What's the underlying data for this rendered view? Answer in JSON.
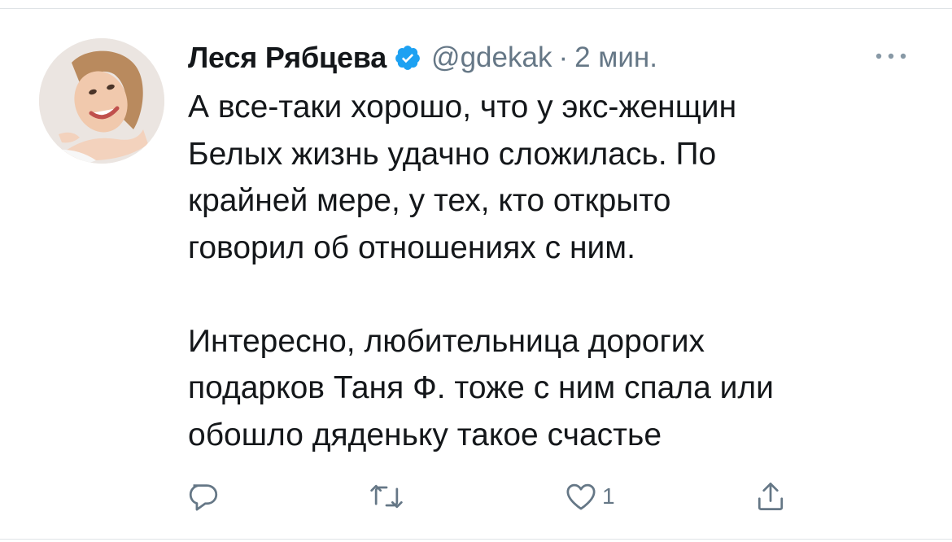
{
  "tweet": {
    "author": {
      "display_name": "Леся Рябцева",
      "handle": "@gdekak",
      "verified": true
    },
    "separator": "·",
    "timestamp": "2 мин.",
    "text_lines_1": [
      "А все-таки хорошо, что у экс-женщин",
      "Белых жизнь удачно сложилась. По",
      "крайней мере, у тех, кто открыто",
      "говорил об отношениях с ним."
    ],
    "text_lines_2": [
      "Интересно, любительница дорогих",
      "подарков Таня Ф. тоже с ним спала или",
      "обошло дяденьку такое счастье"
    ],
    "actions": {
      "like_count": "1"
    }
  },
  "colors": {
    "text_primary": "#14171a",
    "text_secondary": "#657786",
    "verified_blue": "#1da1f2",
    "divider": "#dfe3e6"
  }
}
